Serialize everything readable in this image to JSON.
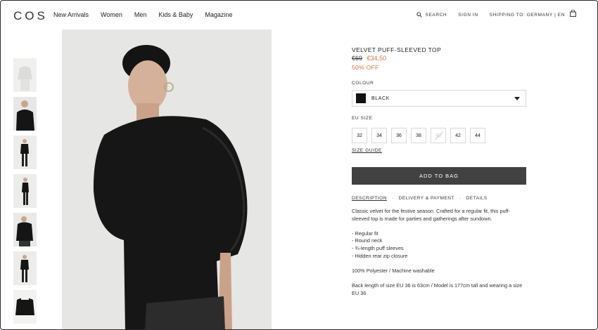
{
  "header": {
    "logo": "COS",
    "nav": [
      "New Arrivals",
      "Women",
      "Men",
      "Kids & Baby",
      "Magazine"
    ],
    "search_label": "SEARCH",
    "sign_in_label": "SIGN IN",
    "shipping_label": "SHIPPING TO: GERMANY | EN"
  },
  "product": {
    "title": "VELVET PUFF-SLEEVED TOP",
    "old_price": "€69",
    "new_price": "€34,50",
    "discount": "50% OFF",
    "colour_label": "COLOUR",
    "colour_value": "BLACK",
    "size_label": "EU SIZE",
    "sizes": [
      "32",
      "34",
      "36",
      "38",
      "40",
      "42",
      "44"
    ],
    "size_guide": "SIZE GUIDE",
    "add_to_bag": "ADD TO BAG",
    "tabs": [
      "DESCRIPTION",
      "DELIVERY & PAYMENT",
      "DETAILS"
    ],
    "tab_separator": "-",
    "description": {
      "intro": "Classic velvet for the festive season. Crafted for a regular fit, this puff-sleeved top is made for parties and gatherings after sundown.",
      "bullets": [
        "- Regular fit",
        "- Round neck",
        "- ¾-length puff sleeves",
        "- Hidden rear zip closure"
      ],
      "material": "100% Polyester / Machine washable",
      "measurements": "Back length of size EU 36 is 63cm / Model is 177cm tall and wearing a size EU 36"
    }
  },
  "colors": {
    "accent_sale": "#d9703f",
    "button_bg": "#414141",
    "swatch": "#111111"
  }
}
